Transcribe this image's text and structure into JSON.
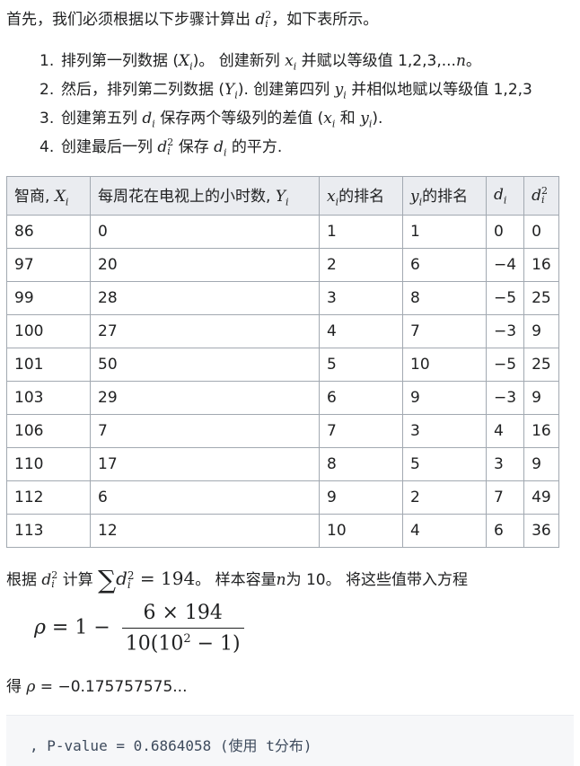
{
  "intro": {
    "before": "首先，我们必须根据以下步骤计算出 ",
    "math": "d",
    "sup": "2",
    "sub": "i",
    "after": "，如下表所示。"
  },
  "steps": [
    {
      "num": "1.",
      "a": "排列第一列数据 (",
      "m1": "X",
      "m1sub": "i",
      "b": ")。 创建新列 ",
      "m2": "x",
      "m2sub": "i",
      "c": " 并赋以等级值 1,2,3,...",
      "m3": "n",
      "d": "。"
    },
    {
      "num": "2.",
      "a": "然后，排列第二列数据 (",
      "m1": "Y",
      "m1sub": "i",
      "b": "). 创建第四列 ",
      "m2": "y",
      "m2sub": "i",
      "c": " 并相似地赋以等级值 1,2,3"
    },
    {
      "num": "3.",
      "a": "创建第五列 ",
      "m1": "d",
      "m1sub": "i",
      "b": " 保存两个等级列的差值 (",
      "m2": "x",
      "m2sub": "i",
      "c": " 和 ",
      "m3": "y",
      "m3sub": "i",
      "d": ")."
    },
    {
      "num": "4.",
      "a": "创建最后一列 ",
      "m1": "d",
      "m1sup": "2",
      "m1sub": "i",
      "b": " 保存 ",
      "m2": "d",
      "m2sub": "i",
      "c": " 的平方."
    }
  ],
  "table": {
    "headers": [
      {
        "text": "智商, ",
        "m": "X",
        "sub": "i"
      },
      {
        "text": "每周花在电视上的小时数, ",
        "m": "Y",
        "sub": "i"
      },
      {
        "pre": "",
        "m": "x",
        "sub": "i",
        "text": "的排名"
      },
      {
        "pre": "",
        "m": "y",
        "sub": "i",
        "text": "的排名"
      },
      {
        "m": "d",
        "sub": "i"
      },
      {
        "m": "d",
        "sup": "2",
        "sub": "i"
      }
    ],
    "rows": [
      [
        "86",
        "0",
        "1",
        "1",
        "0",
        "0"
      ],
      [
        "97",
        "20",
        "2",
        "6",
        "−4",
        "16"
      ],
      [
        "99",
        "28",
        "3",
        "8",
        "−5",
        "25"
      ],
      [
        "100",
        "27",
        "4",
        "7",
        "−3",
        "9"
      ],
      [
        "101",
        "50",
        "5",
        "10",
        "−5",
        "25"
      ],
      [
        "103",
        "29",
        "6",
        "9",
        "−3",
        "9"
      ],
      [
        "106",
        "7",
        "7",
        "3",
        "4",
        "16"
      ],
      [
        "110",
        "17",
        "8",
        "5",
        "3",
        "9"
      ],
      [
        "112",
        "6",
        "9",
        "2",
        "7",
        "49"
      ],
      [
        "113",
        "12",
        "10",
        "4",
        "6",
        "36"
      ]
    ]
  },
  "para": {
    "a": "根据 ",
    "m1": "d",
    "m1sup": "2",
    "m1sub": "i",
    "b": " 计算 ",
    "sum": "∑",
    "m2": "d",
    "m2sup": "2",
    "m2sub": "i",
    "eq": " = 194",
    "c": "。 样本容量",
    "n": "n",
    "d": "为 10。 将这些值带入方程"
  },
  "formula": {
    "lhs": "ρ",
    "eq": " = 1 − ",
    "numerator": "6 × 194",
    "denominator_a": "10(10",
    "denominator_sup": "2",
    "denominator_b": " − 1)"
  },
  "result": {
    "a": "得 ",
    "rho": "ρ",
    "b": " = −0.175757575..."
  },
  "code": {
    "line": ", P-value = 0.6864058 (使用 t分布)"
  }
}
